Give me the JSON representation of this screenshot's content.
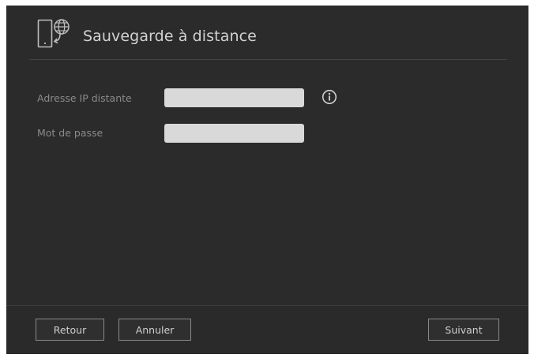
{
  "header": {
    "title": "Sauvegarde à distance",
    "icon": "remote-backup-icon"
  },
  "form": {
    "remote_ip": {
      "label": "Adresse IP distante",
      "value": "",
      "info_icon": "info-icon"
    },
    "password": {
      "label": "Mot de passe",
      "value": ""
    }
  },
  "footer": {
    "back_label": "Retour",
    "cancel_label": "Annuler",
    "next_label": "Suivant"
  },
  "colors": {
    "dialog_bg": "#2b2b2b",
    "input_bg": "#d9d9d9",
    "text": "#d2d2d2",
    "label": "#8a8a8a"
  }
}
